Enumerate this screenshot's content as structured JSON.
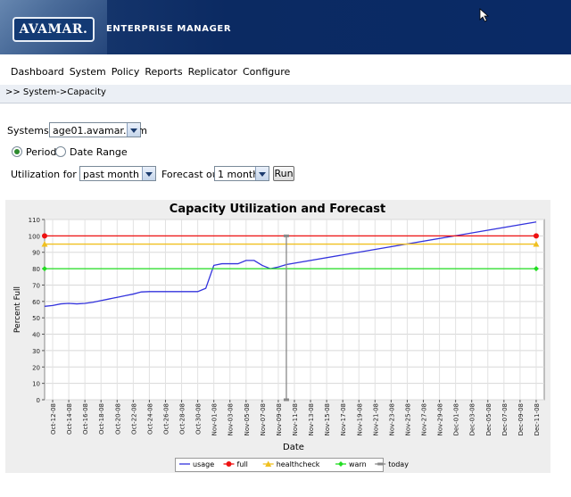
{
  "header": {
    "logo_text": "AVAMAR.",
    "product_title": "ENTERPRISE MANAGER"
  },
  "menu": {
    "items": [
      "Dashboard",
      "System",
      "Policy",
      "Reports",
      "Replicator",
      "Configure"
    ]
  },
  "breadcrumb": ">> System->Capacity",
  "form": {
    "systems_label": "Systems:",
    "system_value": "age01.avamar.com",
    "period_label": "Period",
    "date_range_label": "Date Range",
    "period_selected": "Period",
    "utilization_label": "Utilization for the",
    "utilization_value": "past month",
    "forecast_label": "Forecast out",
    "forecast_value": "1 month",
    "run_label": "Run"
  },
  "chart_data": {
    "type": "line",
    "title": "Capacity Utilization and Forecast",
    "xlabel": "Date",
    "ylabel": "Percent Full",
    "ylim": [
      0,
      110
    ],
    "yticks": [
      0,
      10,
      20,
      30,
      40,
      50,
      60,
      70,
      80,
      90,
      100,
      110
    ],
    "xlim": [
      "Oct-11-08",
      "Dec-12-08"
    ],
    "x_tick_labels": [
      "Oct-12-08",
      "Oct-14-08",
      "Oct-16-08",
      "Oct-18-08",
      "Oct-20-08",
      "Oct-22-08",
      "Oct-24-08",
      "Oct-26-08",
      "Oct-28-08",
      "Oct-30-08",
      "Nov-01-08",
      "Nov-03-08",
      "Nov-05-08",
      "Nov-07-08",
      "Nov-09-08",
      "Nov-11-08",
      "Nov-13-08",
      "Nov-15-08",
      "Nov-17-08",
      "Nov-19-08",
      "Nov-21-08",
      "Nov-23-08",
      "Nov-25-08",
      "Nov-27-08",
      "Nov-29-08",
      "Dec-01-08",
      "Dec-03-08",
      "Dec-05-08",
      "Dec-07-08",
      "Dec-09-08",
      "Dec-11-08"
    ],
    "grid": true,
    "legend_position": "bottom-center",
    "series": [
      {
        "name": "usage",
        "color": "#3333dd",
        "marker": "none",
        "points": [
          [
            "Oct-11-08",
            57
          ],
          [
            "Oct-12-08",
            57.5
          ],
          [
            "Oct-13-08",
            58.5
          ],
          [
            "Oct-14-08",
            58.8
          ],
          [
            "Oct-15-08",
            58.5
          ],
          [
            "Oct-16-08",
            58.8
          ],
          [
            "Oct-17-08",
            59.5
          ],
          [
            "Oct-18-08",
            60.5
          ],
          [
            "Oct-19-08",
            61.5
          ],
          [
            "Oct-20-08",
            62.5
          ],
          [
            "Oct-21-08",
            63.5
          ],
          [
            "Oct-22-08",
            64.5
          ],
          [
            "Oct-23-08",
            65.8
          ],
          [
            "Oct-24-08",
            66
          ],
          [
            "Oct-25-08",
            66
          ],
          [
            "Oct-26-08",
            66
          ],
          [
            "Oct-27-08",
            66
          ],
          [
            "Oct-28-08",
            66
          ],
          [
            "Oct-29-08",
            66
          ],
          [
            "Oct-30-08",
            66
          ],
          [
            "Oct-31-08",
            68
          ],
          [
            "Nov-01-08",
            82
          ],
          [
            "Nov-02-08",
            83
          ],
          [
            "Nov-03-08",
            83
          ],
          [
            "Nov-04-08",
            83
          ],
          [
            "Nov-05-08",
            85
          ],
          [
            "Nov-06-08",
            85
          ],
          [
            "Nov-07-08",
            82
          ],
          [
            "Nov-08-08",
            80
          ],
          [
            "Nov-09-08",
            81
          ],
          [
            "Nov-10-08",
            82.5
          ],
          [
            "Dec-11-08",
            108.5
          ]
        ]
      },
      {
        "name": "full",
        "color": "#ee1111",
        "marker": "circle",
        "points": [
          [
            "Oct-11-08",
            100
          ],
          [
            "Dec-11-08",
            100
          ]
        ]
      },
      {
        "name": "healthcheck",
        "color": "#f0c020",
        "marker": "triangle",
        "points": [
          [
            "Oct-11-08",
            95
          ],
          [
            "Dec-11-08",
            95
          ]
        ]
      },
      {
        "name": "warn",
        "color": "#22dd22",
        "marker": "diamond",
        "points": [
          [
            "Oct-11-08",
            80
          ],
          [
            "Dec-11-08",
            80
          ]
        ]
      },
      {
        "name": "today",
        "color": "#888888",
        "marker": "dash",
        "points": [
          [
            "Nov-10-08",
            0
          ],
          [
            "Nov-10-08",
            100
          ]
        ]
      }
    ]
  }
}
